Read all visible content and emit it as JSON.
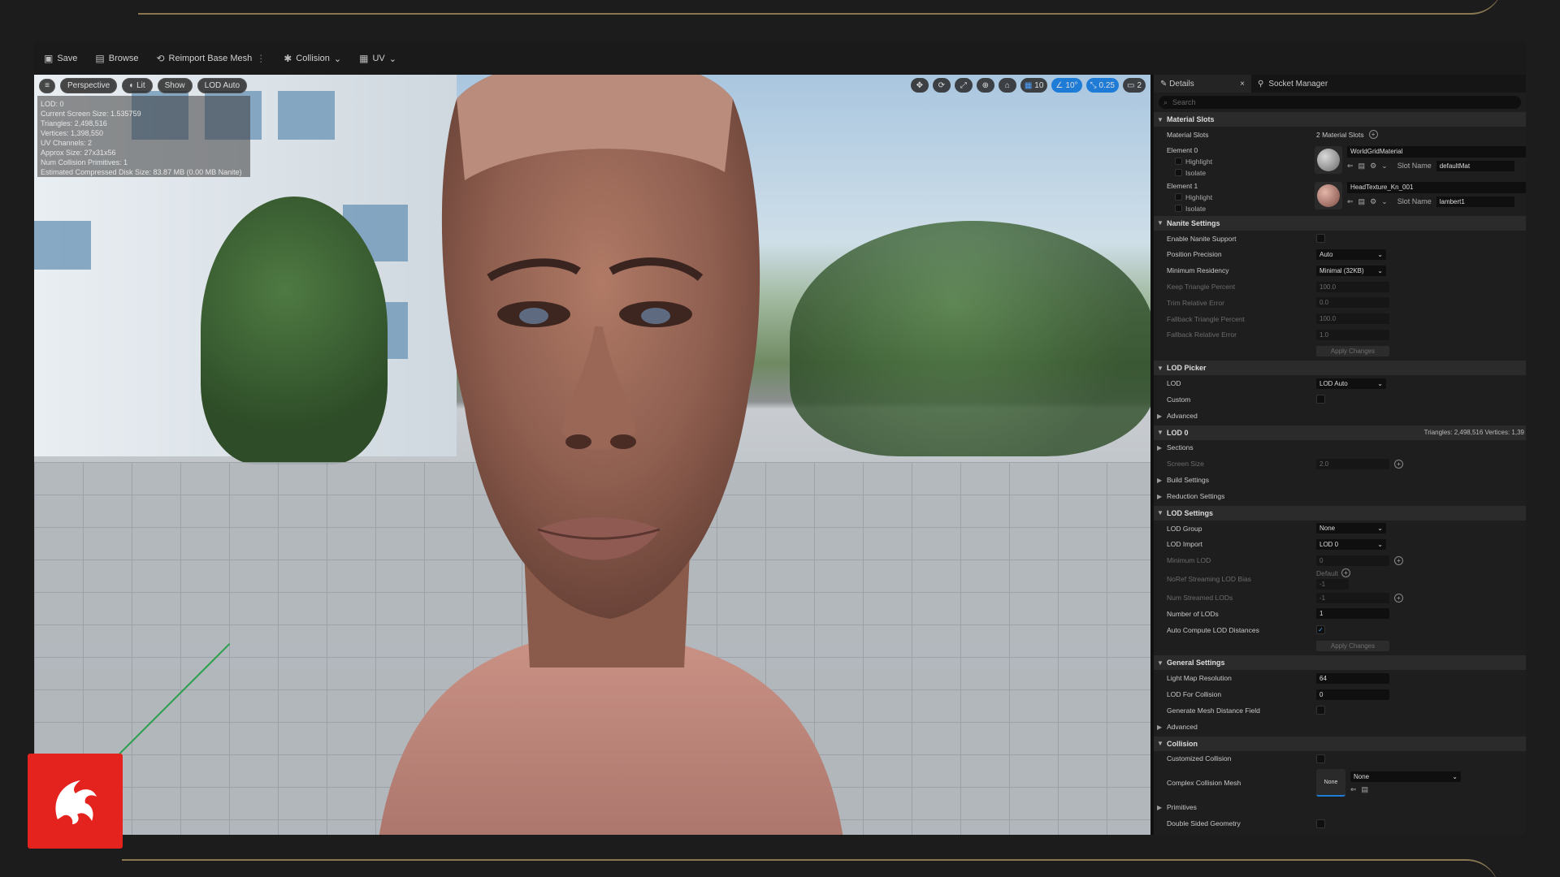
{
  "toolbar": {
    "save": "Save",
    "browse": "Browse",
    "reimport": "Reimport Base Mesh",
    "collision": "Collision",
    "uv": "UV"
  },
  "viewport": {
    "perspective": "Perspective",
    "lit": "Lit",
    "show": "Show",
    "lod_auto": "LOD Auto",
    "grid_value": "10",
    "angle_value": "10°",
    "scale_value": "0.25",
    "camera_value": "2",
    "stats": [
      "LOD: 0",
      "Current Screen Size: 1.535759",
      "Triangles: 2,498,516",
      "Vertices: 1,398,550",
      "UV Channels: 2",
      "Approx Size: 27x31x56",
      "Num Collision Primitives: 1",
      "Estimated Compressed Disk Size: 83.87 MB (0.00 MB Nanite)"
    ]
  },
  "details": {
    "tab_details": "Details",
    "tab_socket": "Socket Manager",
    "search_placeholder": "Search",
    "material_slots": {
      "title": "Material Slots",
      "label": "Material Slots",
      "count": "2 Material Slots",
      "elements": [
        {
          "name": "Element 0",
          "highlight": "Highlight",
          "isolate": "Isolate",
          "material": "WorldGridMaterial",
          "slot_label": "Slot Name",
          "slot": "defaultMat"
        },
        {
          "name": "Element 1",
          "highlight": "Highlight",
          "isolate": "Isolate",
          "material": "HeadTexture_Kn_001",
          "slot_label": "Slot Name",
          "slot": "lambert1"
        }
      ]
    },
    "nanite": {
      "title": "Nanite Settings",
      "enable": "Enable Nanite Support",
      "position_precision": "Position Precision",
      "position_precision_value": "Auto",
      "min_residency": "Minimum Residency",
      "min_residency_value": "Minimal (32KB)",
      "keep_triangle": "Keep Triangle Percent",
      "keep_triangle_value": "100.0",
      "trim_error": "Trim Relative Error",
      "trim_error_value": "0.0",
      "fallback_triangle": "Fallback Triangle Percent",
      "fallback_triangle_value": "100.0",
      "fallback_error": "Fallback Relative Error",
      "fallback_error_value": "1.0",
      "apply": "Apply Changes"
    },
    "lod_picker": {
      "title": "LOD Picker",
      "lod": "LOD",
      "lod_value": "LOD Auto",
      "custom": "Custom",
      "advanced": "Advanced"
    },
    "lod0": {
      "title": "LOD 0",
      "stats": "Triangles: 2,498,516    Vertices: 1,39",
      "sections": "Sections",
      "screen_size": "Screen Size",
      "screen_size_value": "2.0",
      "build": "Build Settings",
      "reduction": "Reduction Settings"
    },
    "lod_settings": {
      "title": "LOD Settings",
      "group": "LOD Group",
      "group_value": "None",
      "import": "LOD Import",
      "import_value": "LOD 0",
      "min_lod": "Minimum LOD",
      "min_lod_value": "0",
      "noref": "NoRef Streaming LOD Bias",
      "noref_default": "Default",
      "noref_value": "-1",
      "num_streamed": "Num Streamed LODs",
      "num_streamed_value": "-1",
      "num_lods": "Number of LODs",
      "num_lods_value": "1",
      "auto_compute": "Auto Compute LOD Distances",
      "apply": "Apply Changes"
    },
    "general": {
      "title": "General Settings",
      "lightmap": "Light Map Resolution",
      "lightmap_value": "64",
      "lod_collision": "LOD For Collision",
      "lod_collision_value": "0",
      "distance_field": "Generate Mesh Distance Field",
      "advanced": "Advanced"
    },
    "collision": {
      "title": "Collision",
      "customized": "Customized Collision",
      "complex_mesh": "Complex Collision Mesh",
      "complex_thumb": "None",
      "complex_value": "None",
      "primitives": "Primitives",
      "double_sided": "Double Sided Geometry"
    }
  },
  "colors": {
    "accent_blue": "#1e7bd6",
    "logo_red": "#e4231f",
    "frame_gold": "#8a7752"
  }
}
